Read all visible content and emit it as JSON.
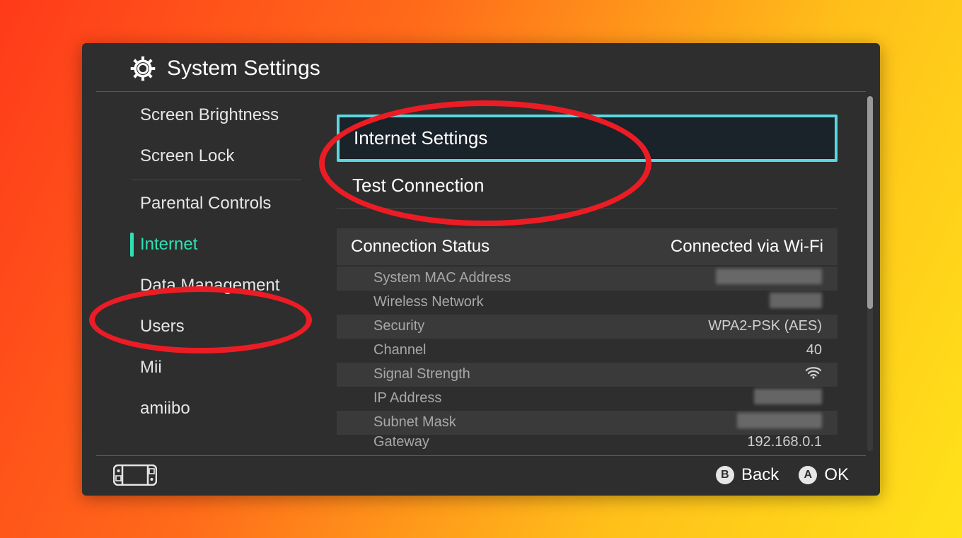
{
  "header": {
    "title": "System Settings"
  },
  "sidebar": {
    "groups": [
      {
        "items": [
          {
            "label": "Screen Brightness",
            "active": false
          },
          {
            "label": "Screen Lock",
            "active": false
          }
        ]
      },
      {
        "items": [
          {
            "label": "Parental Controls",
            "active": false
          },
          {
            "label": "Internet",
            "active": true
          },
          {
            "label": "Data Management",
            "active": false
          },
          {
            "label": "Users",
            "active": false
          },
          {
            "label": "Mii",
            "active": false
          },
          {
            "label": "amiibo",
            "active": false
          }
        ]
      }
    ]
  },
  "content": {
    "menu": [
      {
        "label": "Internet Settings",
        "highlighted": true
      },
      {
        "label": "Test Connection",
        "highlighted": false
      }
    ],
    "status_header_label": "Connection Status",
    "status_header_value": "Connected via Wi-Fi",
    "rows": [
      {
        "label": "System MAC Address",
        "value": "",
        "blurred": true,
        "blur_width": 150
      },
      {
        "label": "Wireless Network",
        "value": "",
        "blurred": true,
        "blur_width": 74
      },
      {
        "label": "Security",
        "value": "WPA2-PSK (AES)",
        "blurred": false
      },
      {
        "label": "Channel",
        "value": "40",
        "blurred": false
      },
      {
        "label": "Signal Strength",
        "value": "wifi-icon",
        "blurred": false,
        "icon": true
      },
      {
        "label": "IP Address",
        "value": "",
        "blurred": true,
        "blur_width": 96
      },
      {
        "label": "Subnet Mask",
        "value": "",
        "blurred": true,
        "blur_width": 120
      },
      {
        "label": "Gateway",
        "value": "192.168.0.1",
        "blurred": false,
        "cut": true
      }
    ]
  },
  "footer": {
    "hints": [
      {
        "button": "B",
        "label": "Back"
      },
      {
        "button": "A",
        "label": "OK"
      }
    ]
  }
}
